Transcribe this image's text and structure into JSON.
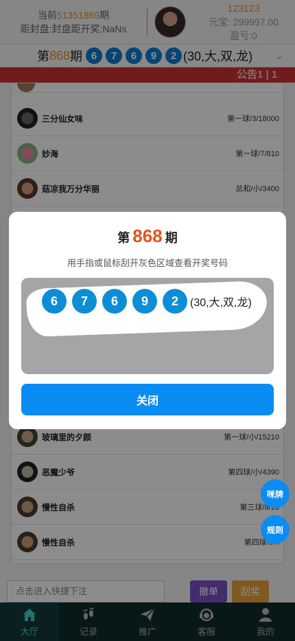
{
  "header": {
    "current_issue_prefix": "当前",
    "current_issue_number": "51351869",
    "current_issue_suffix": "期",
    "countdown_text": "距封盘:封盘距开奖:NaNs",
    "user_id": "123123",
    "balance": "元宝: 299997.00",
    "profit": "盈亏:0"
  },
  "issue_bar": {
    "prefix": "第",
    "number": "868",
    "suffix": "期",
    "balls": [
      "6",
      "7",
      "6",
      "9",
      "2"
    ],
    "result_desc": "(30,大,双,龙)"
  },
  "notice": {
    "text": "公告1  |  1"
  },
  "bets": [
    {
      "name": "三分仙女味",
      "bet": "第一球/3/18000"
    },
    {
      "name": "妙海",
      "bet": "第一球/7/810"
    },
    {
      "name": "菇凉我万分华丽",
      "bet": "总和/小/3400"
    },
    {
      "name": "玻璃里的夕颜",
      "bet": "第一球/小/15210"
    },
    {
      "name": "恶魔少爷",
      "bet": "第四球/小/4390"
    },
    {
      "name": "慢性自杀",
      "bet": "第三球/8/16"
    },
    {
      "name": "慢性自杀",
      "bet": "第四球/5/4"
    }
  ],
  "modal": {
    "title_prefix": "第",
    "issue_number": "868",
    "title_suffix": "期",
    "instruction": "用手指或鼠标刮开灰色区域查看开奖号码",
    "balls": [
      "6",
      "7",
      "6",
      "9",
      "2"
    ],
    "result_desc": "(30,大,双,龙)",
    "close_label": "关闭"
  },
  "floating": {
    "chat_label": "咪牌",
    "rules_label": "规则"
  },
  "quick_bet": {
    "placeholder": "点击进入快捷下注",
    "cancel_label": "撤单",
    "scratch_label": "刮奖"
  },
  "tabbar": {
    "items": [
      {
        "label": "大厅",
        "icon": "home-icon"
      },
      {
        "label": "记录",
        "icon": "footprint-icon"
      },
      {
        "label": "推广",
        "icon": "paper-plane-icon"
      },
      {
        "label": "客服",
        "icon": "headset-icon"
      },
      {
        "label": "我的",
        "icon": "user-icon"
      }
    ]
  },
  "colors": {
    "accent": "#0a8cf5",
    "ball": "#0b8ed6",
    "notice": "#cc3333",
    "orange": "#e8912d",
    "tabbar": "#0f2a2c",
    "tab_active": "#3fd1c8"
  }
}
